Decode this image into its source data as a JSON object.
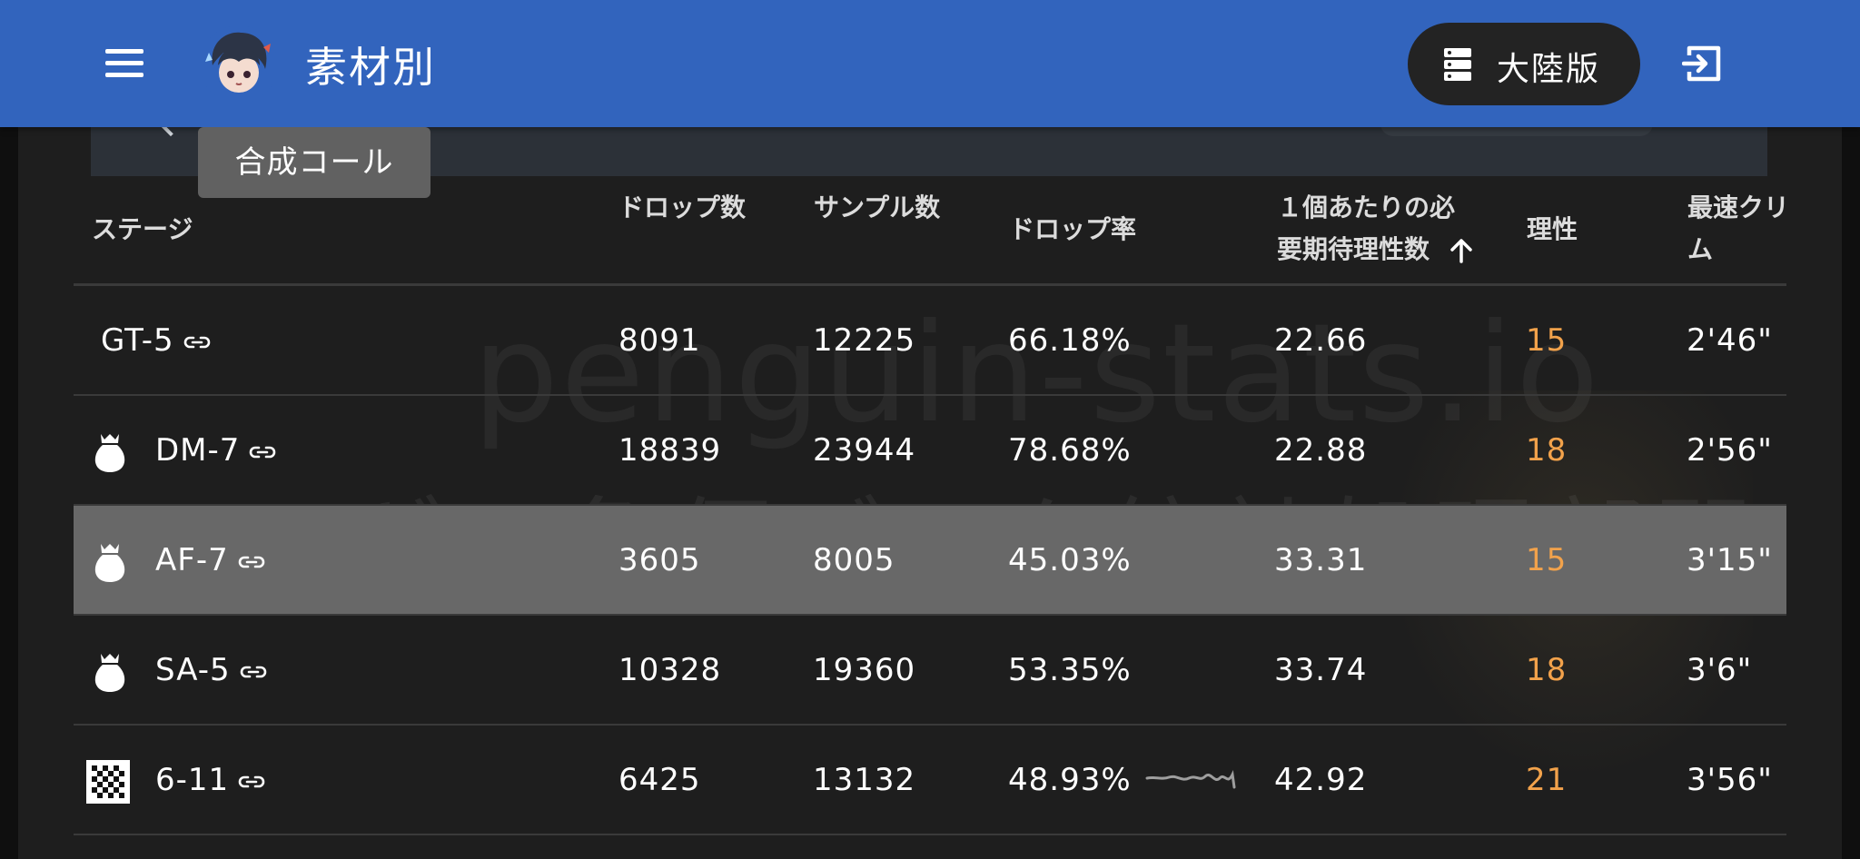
{
  "app_bar": {
    "title": "素材別",
    "server_label": "大陸版"
  },
  "tooltip": "合成コール",
  "watermark": {
    "line1": "penguin-stats.io",
    "line2": "ペンギン急便データ統計処理部門"
  },
  "table": {
    "headers": {
      "stage": "ステージ",
      "drops": "ドロップ数",
      "samples": "サンプル数",
      "drop_rate": "ドロップ率",
      "ap_per_item_line1": "１個あたりの必",
      "ap_per_item_line2": "要期待理性数",
      "ap": "理性",
      "fastest_line1": "最速クリ",
      "fastest_line2": "ム"
    },
    "rows": [
      {
        "stage": "GT-5",
        "icon": "none",
        "drops": "8091",
        "samples": "12225",
        "rate": "66.18%",
        "ap_per_item": "22.66",
        "ap": "15",
        "time": "2'46\""
      },
      {
        "stage": "DM-7",
        "icon": "money-bag-crown-icon",
        "drops": "18839",
        "samples": "23944",
        "rate": "78.68%",
        "ap_per_item": "22.88",
        "ap": "18",
        "time": "2'56\""
      },
      {
        "stage": "AF-7",
        "icon": "money-bag-crown-icon",
        "drops": "3605",
        "samples": "8005",
        "rate": "45.03%",
        "ap_per_item": "33.31",
        "ap": "15",
        "time": "3'15\""
      },
      {
        "stage": "SA-5",
        "icon": "money-bag-crown-icon",
        "drops": "10328",
        "samples": "19360",
        "rate": "53.35%",
        "ap_per_item": "33.74",
        "ap": "18",
        "time": "3'6\""
      },
      {
        "stage": "6-11",
        "icon": "checkered-flag-icon",
        "drops": "6425",
        "samples": "13132",
        "rate": "48.93%",
        "ap_per_item": "42.92",
        "ap": "21",
        "time": "3'56\""
      }
    ],
    "selected_row": "AF-7",
    "sort": {
      "column": "ap_per_item",
      "direction": "ascending"
    }
  },
  "colors": {
    "app_bar": "#3264bd",
    "ap_value": "#f2a24b",
    "selected_row": "#686868",
    "background": "#1e1e1e"
  }
}
